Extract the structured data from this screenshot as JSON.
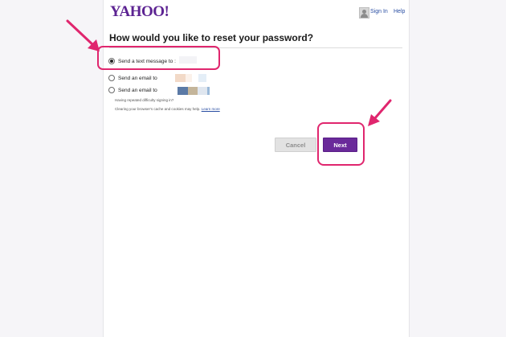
{
  "header": {
    "logo": "YAHOO!",
    "sign_in": "Sign In",
    "help": "Help"
  },
  "form": {
    "title": "How would you like to reset your password?",
    "options": [
      {
        "label": "Send a text message to :",
        "selected": true
      },
      {
        "label": "Send an email to",
        "selected": false
      },
      {
        "label": "Send an email to",
        "selected": false
      }
    ],
    "difficulty_text": "Having repeated difficulty signing in?",
    "clear_cache_text": "Clearing your browser's cache and cookies may help.",
    "learn_more": "Learn more"
  },
  "buttons": {
    "cancel": "Cancel",
    "next": "Next"
  },
  "colors": {
    "brand": "#5c2392",
    "next_button": "#6a2a9a",
    "annotation": "#e0266e"
  },
  "icons": [
    "user-icon",
    "radio-checked",
    "radio-unchecked",
    "annotation-arrow"
  ]
}
